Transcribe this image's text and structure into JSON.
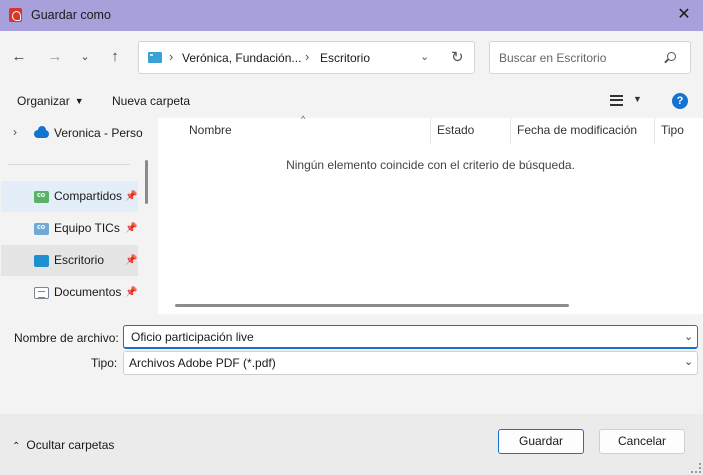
{
  "window": {
    "title": "Guardar como",
    "close_label": "✕"
  },
  "navigation": {
    "address_segments": [
      "Verónica, Fundación...",
      "Escritorio"
    ],
    "search_placeholder": "Buscar en Escritorio"
  },
  "toolbar": {
    "organize_label": "Organizar",
    "new_folder_label": "Nueva carpeta",
    "help_label": "?"
  },
  "sidebar": {
    "top_item": "Veronica - Perso",
    "items": [
      {
        "label": "Compartidos",
        "icon": "shared-folder-icon",
        "state": "hover"
      },
      {
        "label": "Equipo TICs",
        "icon": "team-folder-icon",
        "state": "normal"
      },
      {
        "label": "Escritorio",
        "icon": "desktop-folder-icon",
        "state": "selected"
      },
      {
        "label": "Documentos",
        "icon": "documents-folder-icon",
        "state": "normal"
      }
    ]
  },
  "file_list": {
    "columns": [
      "Nombre",
      "Estado",
      "Fecha de modificación",
      "Tipo"
    ],
    "empty_message": "Ningún elemento coincide con el criterio de búsqueda."
  },
  "save_form": {
    "filename_label": "Nombre de archivo:",
    "filename_value": "Oficio participación live",
    "type_label": "Tipo:",
    "type_value": "Archivos Adobe PDF (*.pdf)"
  },
  "footer": {
    "hide_folders_label": "Ocultar carpetas",
    "save_label": "Guardar",
    "cancel_label": "Cancelar"
  },
  "colors": {
    "titlebar": "#a8a0db",
    "accent": "#1473cf"
  }
}
